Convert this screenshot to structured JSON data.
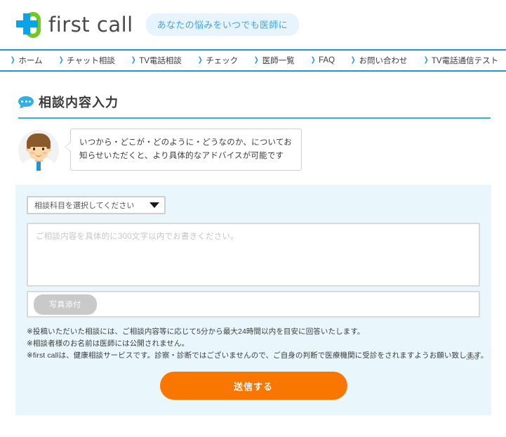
{
  "header": {
    "logo_text": "first call",
    "logo_icon": "first-call-cross-capsule-logo",
    "tagline": "あなたの悩みをいつでも医師に"
  },
  "nav": {
    "arrow_icon": "chevron-right-icon",
    "items": [
      {
        "label": "ホーム"
      },
      {
        "label": "チャット相談"
      },
      {
        "label": "TV電話相談"
      },
      {
        "label": "チェック"
      },
      {
        "label": "医師一覧"
      },
      {
        "label": "FAQ"
      },
      {
        "label": "お問い合わせ"
      },
      {
        "label": "TV電話通信テスト"
      }
    ]
  },
  "page": {
    "title": "相談内容入力",
    "title_icon": "speech-bubble-icon"
  },
  "advice": {
    "avatar_icon": "doctor-avatar",
    "message": "いつから・どこが・どのように・どうなのか、についてお知らせいただくと、より具体的なアドバイスが可能です"
  },
  "form": {
    "subject_select": {
      "selected": "相談科目を選択してください",
      "chevron_icon": "chevron-down-icon"
    },
    "textarea_placeholder": "ご相談内容を具体的に300文字以内でお書きください。",
    "textarea_value": "",
    "attach_button_label": "写真添付",
    "char_count": "300",
    "notes": [
      "※投稿いただいた相談には、ご相談内容等に応じて5分から最大24時間以内を目安に回答いたします。",
      "※相談者様のお名前は医師には公開されません。",
      "※first callは、健康相談サービスです。診察・診断ではございませんので、ご自身の判断で医療機関に受診をされますようお願い致します。"
    ],
    "submit_label": "送信する"
  },
  "colors": {
    "brand_blue": "#2196d6",
    "accent_cyan": "#2fafe3",
    "logo_green": "#72c81e",
    "logo_blue": "#0aa3e8",
    "panel_bg": "#e9f7fd",
    "submit_orange": "#f97600",
    "attach_grey": "#c9c9c9"
  }
}
